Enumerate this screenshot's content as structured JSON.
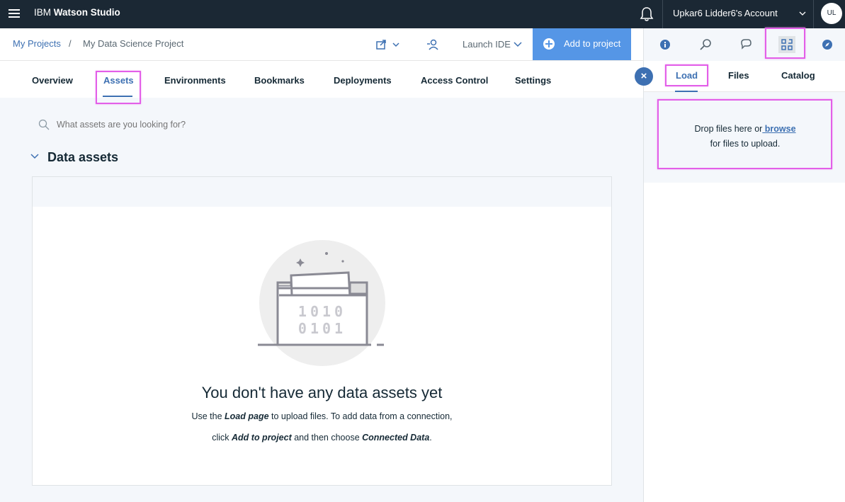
{
  "topbar": {
    "brand_prefix": "IBM",
    "brand_name": "Watson Studio",
    "account": "Upkar6 Lidder6's Account",
    "avatar_initials": "UL"
  },
  "breadcrumb": {
    "root": "My Projects",
    "separator": "/",
    "current": "My Data Science Project"
  },
  "toolbar": {
    "launch_ide": "Launch IDE",
    "add_to_project": "Add to project"
  },
  "tabs": [
    "Overview",
    "Assets",
    "Environments",
    "Bookmarks",
    "Deployments",
    "Access Control",
    "Settings"
  ],
  "active_tab": "Assets",
  "search": {
    "placeholder": "What assets are you looking for?"
  },
  "section": {
    "title": "Data assets"
  },
  "empty_state": {
    "title": "You don't have any data assets yet",
    "line1_pre": "Use the ",
    "line1_em": "Load page",
    "line1_post": " to upload files. To add data from a connection,",
    "line2_pre": "click ",
    "line2_em1": "Add to project",
    "line2_mid": " and then choose ",
    "line2_em2": "Connected Data",
    "line2_post": ".",
    "illustration_row1": "1010",
    "illustration_row2": "0101"
  },
  "right_panel": {
    "tabs": [
      "Load",
      "Files",
      "Catalog"
    ],
    "active_tab": "Load",
    "drop_text": "Drop files here or",
    "browse": " browse",
    "drop_text2": "for files to upload."
  },
  "colors": {
    "accent": "#3d70b2",
    "button": "#5596e6",
    "topbar": "#1b2834",
    "highlight": "#e35fe8"
  }
}
